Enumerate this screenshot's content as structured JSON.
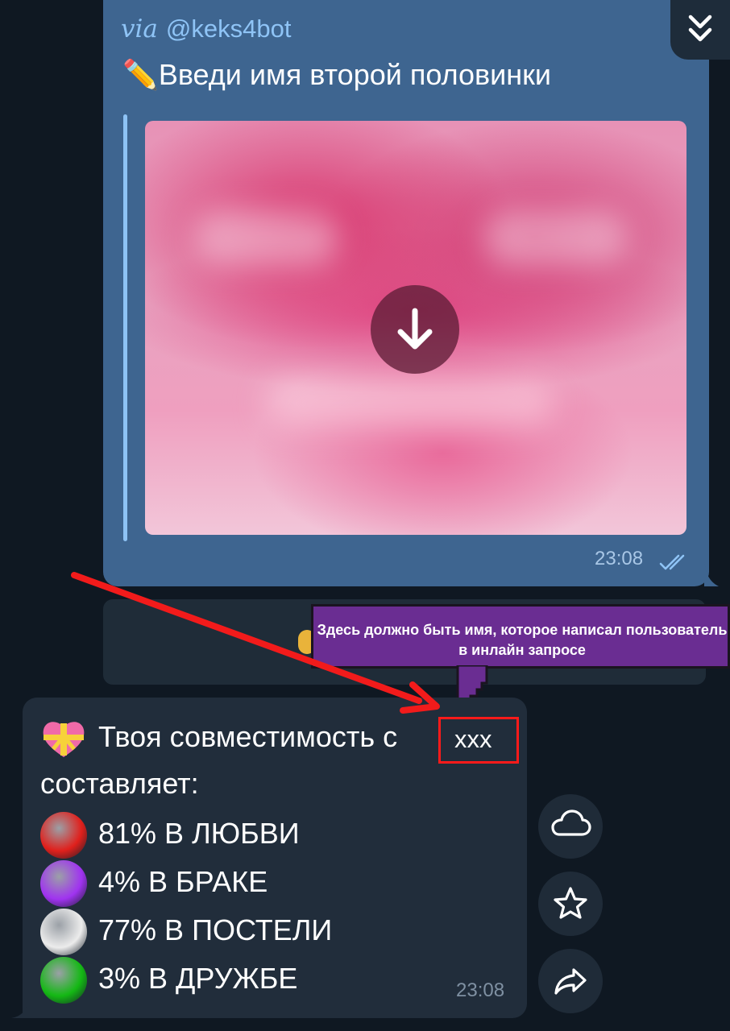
{
  "message_out": {
    "via_label": "via",
    "via_bot": "@keks4bot",
    "title": "✏️Введи имя второй половинки",
    "time": "23:08"
  },
  "annotation": {
    "tooltip": "Здесь должно быть имя, которое написал пользователь в инлайн запросе"
  },
  "message_in": {
    "line1": "Твоя совместимость с",
    "name": "xxx",
    "line2": "составляет:",
    "stats": [
      {
        "text": "81% В ЛЮБВИ",
        "color": "#e0201c"
      },
      {
        "text": "4% В БРАКЕ",
        "color": "#a033f0"
      },
      {
        "text": "77% В ПОСТЕЛИ",
        "color": "#ececec"
      },
      {
        "text": "3% В ДРУЖБЕ",
        "color": "#14b814"
      }
    ],
    "time": "23:08"
  },
  "side_actions": [
    "cloud-icon",
    "star-icon",
    "share-icon"
  ],
  "colors": {
    "background": "#0f1822",
    "outgoing_bubble": "#3e6590",
    "incoming_bubble": "#212d3b",
    "tooltip": "#6a2d92",
    "highlight": "#ff1a1a"
  }
}
